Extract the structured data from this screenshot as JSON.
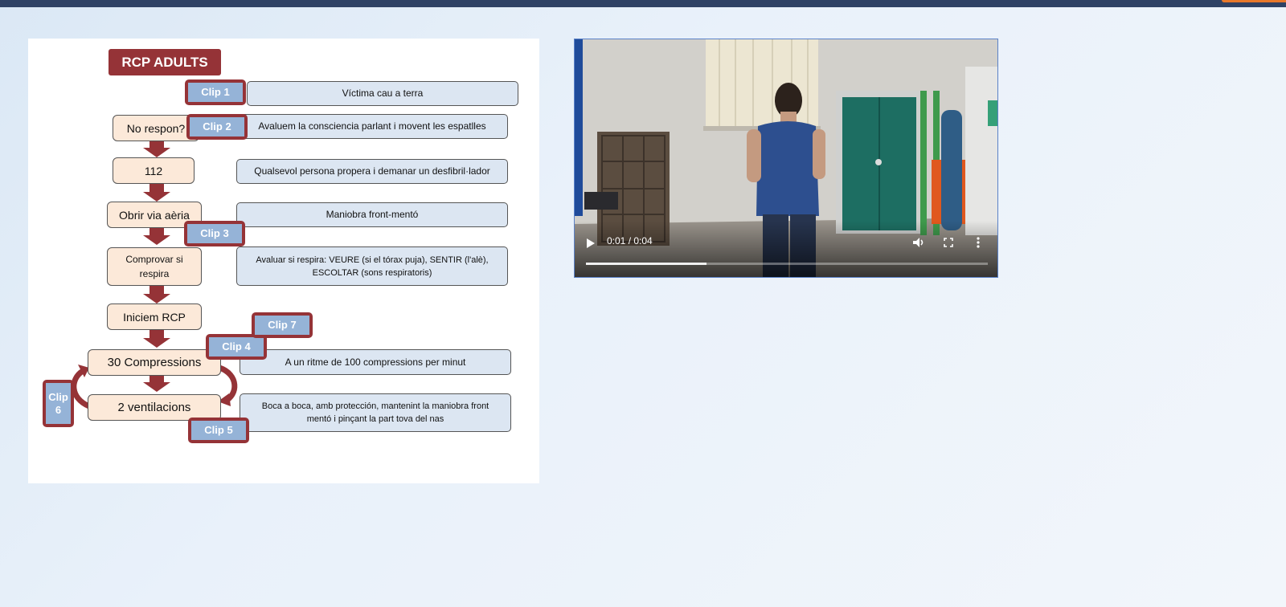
{
  "flowchart": {
    "title": "RCP ADULTS",
    "steps": [
      {
        "label": "No respon?"
      },
      {
        "label": "112"
      },
      {
        "label": "Obrir via aèria"
      },
      {
        "label": "Comprovar si respira"
      },
      {
        "label": "Iniciem RCP"
      },
      {
        "label": "30 Compressions"
      },
      {
        "label": "2 ventilacions"
      }
    ],
    "descriptions": [
      "Víctima cau a terra",
      "Avaluem la consciencia parlant i movent les espatlles",
      "Qualsevol persona propera i demanar un desfibril·lador",
      "Maniobra front-mentó",
      "Avaluar si respira: VEURE (si el tórax puja), SENTIR (l'alè), ESCOLTAR (sons respiratoris)",
      "A un ritme de 100 compressions per minut",
      "Boca a boca, amb protección, mantenint la maniobra front mentó i pinçant la part tova del nas"
    ],
    "clips": [
      "Clip 1",
      "Clip 2",
      "Clip 3",
      "Clip 4",
      "Clip 5",
      "Clip 6",
      "Clip 7"
    ],
    "colors": {
      "title": "#953337",
      "step_fill": "#fce9d9",
      "desc_fill": "#dce6f2",
      "clip_fill": "#95b3d7",
      "clip_border": "#953337"
    }
  },
  "video": {
    "time": "0:01 / 0:04",
    "progress": 0.3,
    "icons": [
      "play-icon",
      "volume-icon",
      "fullscreen-icon",
      "more-options-icon"
    ]
  }
}
